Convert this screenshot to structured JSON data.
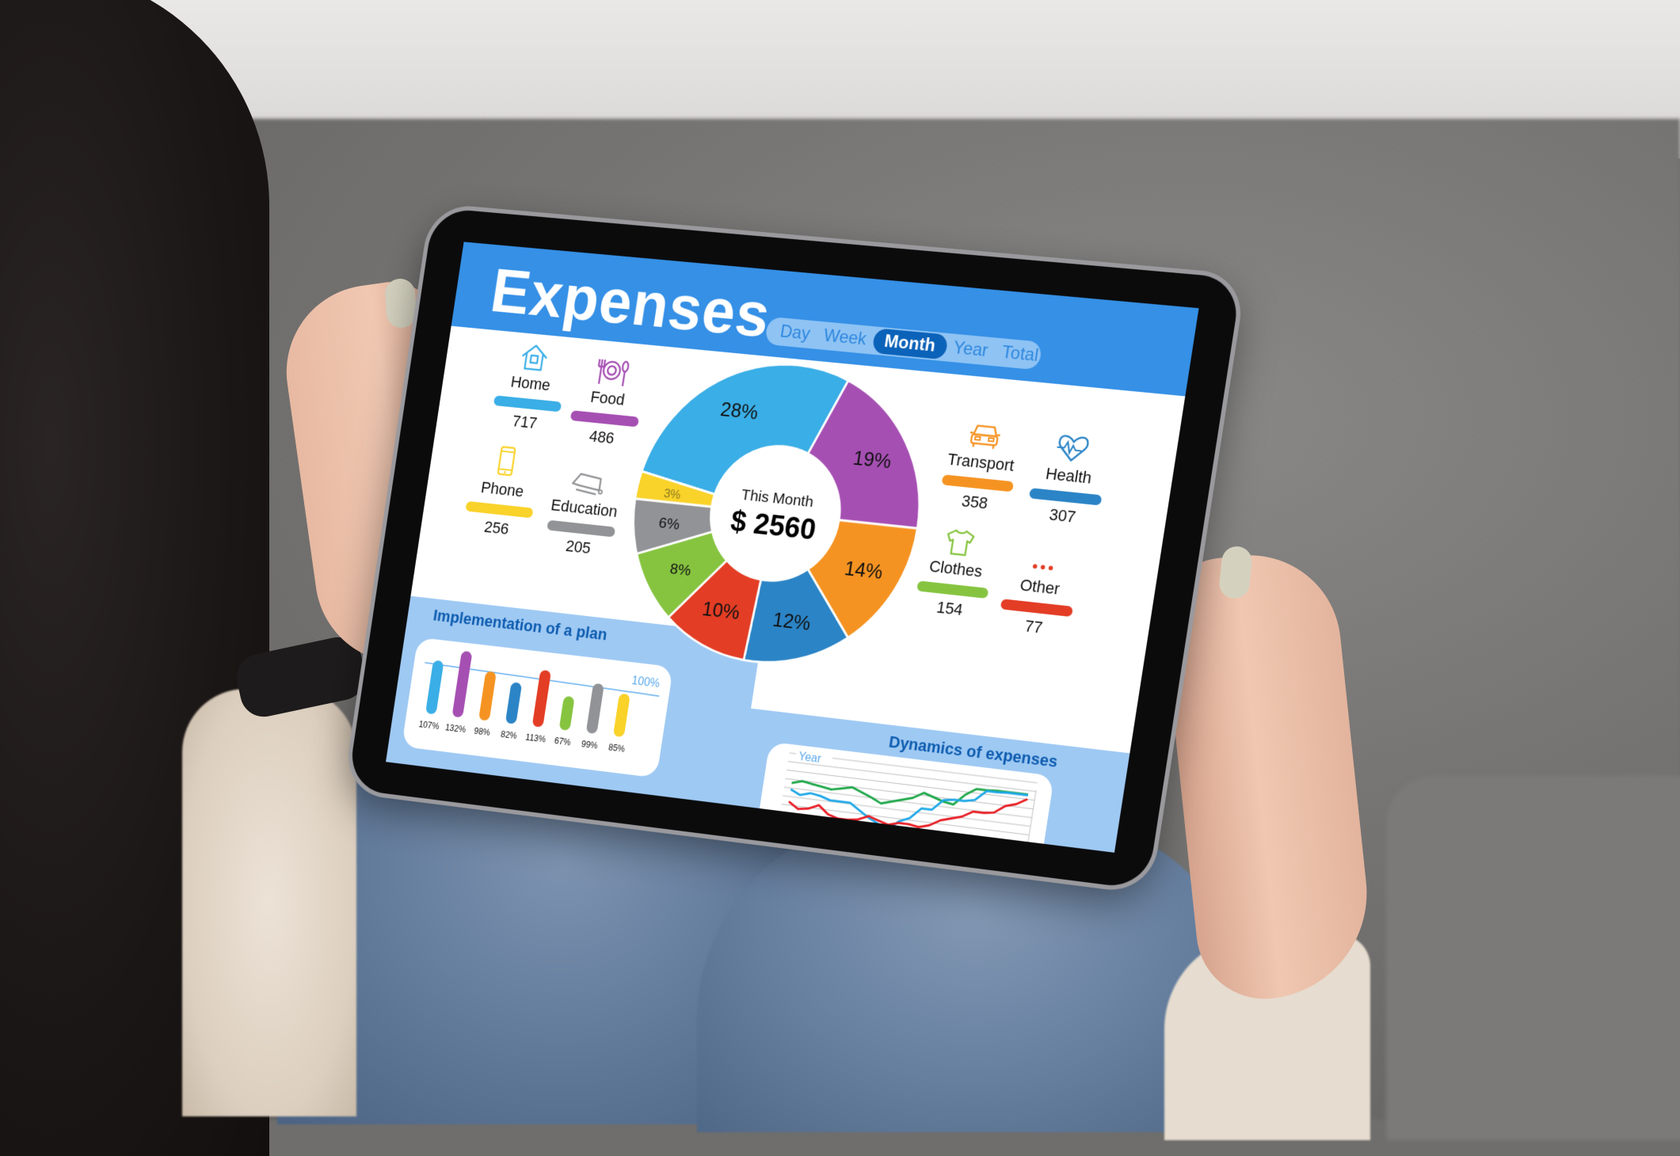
{
  "app": {
    "title": "Expenses",
    "period_tabs": [
      {
        "label": "Day",
        "active": false
      },
      {
        "label": "Week",
        "active": false
      },
      {
        "label": "Month",
        "active": true
      },
      {
        "label": "Year",
        "active": false
      },
      {
        "label": "Total",
        "active": false
      }
    ]
  },
  "summary": {
    "period_label": "This Month",
    "total": "$ 2560"
  },
  "categories": [
    {
      "name": "Home",
      "value": "717",
      "icon": "home-icon",
      "color": "#3aaee6"
    },
    {
      "name": "Food",
      "value": "486",
      "icon": "food-plate-icon",
      "color": "#a64fb3"
    },
    {
      "name": "Phone",
      "value": "256",
      "icon": "smartphone-icon",
      "color": "#f9d22a"
    },
    {
      "name": "Education",
      "value": "205",
      "icon": "graduation-cap-icon",
      "color": "#929396"
    },
    {
      "name": "Transport",
      "value": "358",
      "icon": "car-icon",
      "color": "#f59322"
    },
    {
      "name": "Health",
      "value": "307",
      "icon": "heart-pulse-icon",
      "color": "#2b84c6"
    },
    {
      "name": "Clothes",
      "value": "154",
      "icon": "tshirt-icon",
      "color": "#86c440"
    },
    {
      "name": "Other",
      "value": "77",
      "icon": "more-dots-icon",
      "color": "#e33d25"
    }
  ],
  "chart_data": [
    {
      "type": "pie",
      "title": "This Month",
      "center_value": "$ 2560",
      "categories": [
        "Home",
        "Food",
        "Transport",
        "Health",
        "Other",
        "Clothes",
        "Education",
        "Phone"
      ],
      "values": [
        28,
        19,
        14,
        12,
        10,
        8,
        6,
        3
      ],
      "labels": [
        "28%",
        "19%",
        "14%",
        "12%",
        "10%",
        "8%",
        "6%",
        "3%"
      ],
      "colors": [
        "#3aaee6",
        "#a64fb3",
        "#f59322",
        "#2b84c6",
        "#e33d25",
        "#86c440",
        "#929396",
        "#f9d22a"
      ],
      "donut": true
    },
    {
      "type": "bar",
      "title": "Implementation of a plan",
      "categories": [
        "Home",
        "Food",
        "Transport",
        "Health",
        "Other",
        "Clothes",
        "Education",
        "Phone"
      ],
      "values": [
        107,
        132,
        98,
        82,
        113,
        67,
        99,
        85
      ],
      "labels": [
        "107%",
        "132%",
        "98%",
        "82%",
        "113%",
        "67%",
        "99%",
        "85%"
      ],
      "colors": [
        "#3aaee6",
        "#a64fb3",
        "#f59322",
        "#2b84c6",
        "#e33d25",
        "#86c440",
        "#929396",
        "#f9d22a"
      ],
      "reference_line": {
        "value": 100,
        "label": "100%"
      },
      "ylim": [
        0,
        140
      ]
    },
    {
      "type": "line",
      "title": "Dynamics of expenses",
      "legend_label": "Year",
      "grid": true,
      "x": [
        1,
        2,
        3,
        4,
        5,
        6,
        7,
        8,
        9,
        10,
        11,
        12,
        13,
        14,
        15,
        16,
        17,
        18,
        19,
        20,
        21,
        22,
        23,
        24
      ],
      "ylim": [
        0,
        10
      ],
      "series": [
        {
          "name": "green",
          "color": "#1fa84a",
          "values": [
            6.2,
            6.6,
            6.4,
            6.2,
            6.0,
            6.3,
            6.6,
            6.1,
            5.6,
            5.0,
            5.4,
            5.8,
            6.2,
            7.0,
            6.6,
            6.2,
            6.0,
            7.4,
            8.3,
            8.3,
            8.4,
            8.4,
            8.4,
            8.4
          ]
        },
        {
          "name": "blue",
          "color": "#1fa8e8",
          "values": [
            5.4,
            4.8,
            5.2,
            5.0,
            4.6,
            4.6,
            4.6,
            3.8,
            3.0,
            2.4,
            1.8,
            3.0,
            3.6,
            5.0,
            5.0,
            6.4,
            6.6,
            6.6,
            6.9,
            8.2,
            8.2,
            8.3,
            8.3,
            8.3
          ]
        },
        {
          "name": "red",
          "color": "#e81d25",
          "values": [
            3.8,
            3.0,
            3.2,
            3.8,
            2.8,
            2.4,
            2.4,
            2.6,
            3.2,
            2.8,
            2.4,
            2.8,
            2.8,
            2.6,
            3.0,
            3.8,
            4.2,
            4.6,
            5.4,
            5.4,
            5.6,
            6.6,
            7.0,
            7.8
          ]
        }
      ]
    }
  ]
}
